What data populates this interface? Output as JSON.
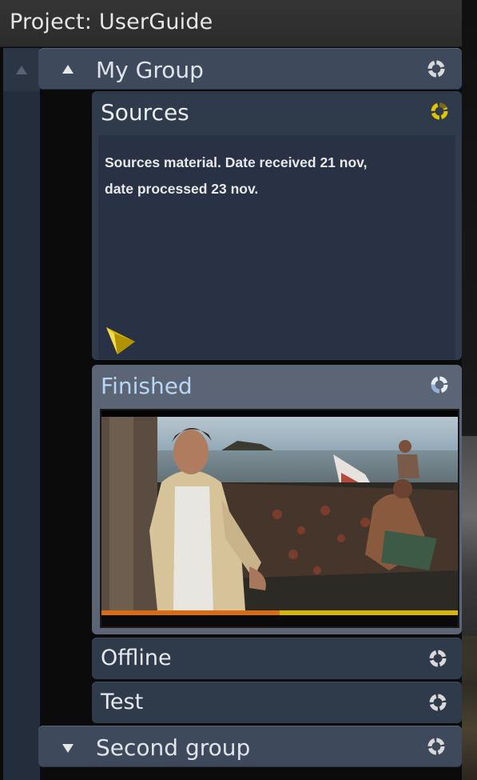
{
  "project": {
    "title": "Project: UserGuide"
  },
  "groups": [
    {
      "label": "My Group",
      "expanded": true
    },
    {
      "label": "Second group",
      "expanded": false
    }
  ],
  "folders": {
    "sources": {
      "label": "Sources",
      "note_line1": "Sources material. Date received 21 nov,",
      "note_line2": "date processed 23 nov.",
      "status_color": "#e0c400"
    },
    "finished": {
      "label": "Finished",
      "status_color": "#bcd7f0",
      "progress": 0.5
    },
    "offline": {
      "label": "Offline"
    },
    "test": {
      "label": "Test"
    }
  },
  "icons": {
    "collapse": "triangle-up-icon",
    "expand": "triangle-down-icon",
    "status": "spinner-ring-icon",
    "note_flag": "note-flag-icon"
  },
  "colors": {
    "panel": "#2f3a4b",
    "group_row": "#3e4a5c",
    "selected": "#5b6576",
    "progress_orange": "#d96c12",
    "progress_yellow": "#d8b600"
  }
}
